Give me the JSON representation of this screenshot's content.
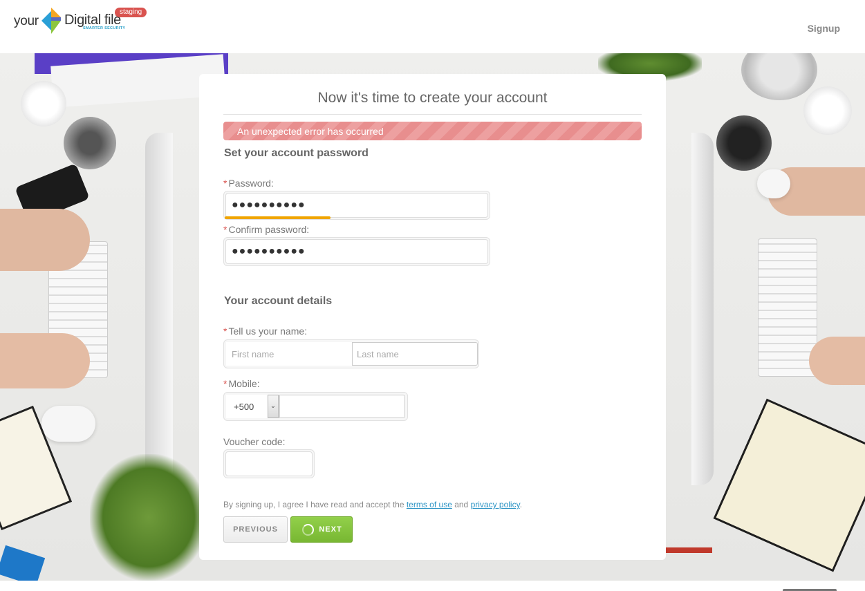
{
  "header": {
    "logo": {
      "your": "your",
      "digital": "Digital file",
      "tm": "®",
      "tagline": "SMARTER SECURITY",
      "badge": "staging"
    },
    "signup_link": "Signup"
  },
  "form": {
    "title": "Now it's time to create your account",
    "error": "An unexpected error has occurred",
    "password_section": {
      "heading": "Set your account password",
      "password_label": "Password:",
      "password_value": "●●●●●●●●●●",
      "confirm_label": "Confirm password:",
      "confirm_value": "●●●●●●●●●●",
      "required_mark": "*"
    },
    "details_section": {
      "heading": "Your account details",
      "name_label": "Tell us your name:",
      "first_name_placeholder": "First name",
      "last_name_placeholder": "Last name",
      "mobile_label": "Mobile:",
      "dial_code": "+500",
      "mobile_value": "",
      "voucher_label": "Voucher code:",
      "voucher_value": ""
    },
    "legal": {
      "prefix": "By signing up, I agree I have read and accept the ",
      "terms": "terms of use",
      "conjunction": " and ",
      "privacy": "privacy policy",
      "suffix": "."
    },
    "buttons": {
      "previous": "PREVIOUS",
      "next": "NEXT"
    }
  },
  "colors": {
    "error": "#e88e8e",
    "next_button": "#84c43c",
    "password_strength": "#f0a500",
    "link": "#2a93c4",
    "badge": "#d9534f"
  },
  "icons": {
    "dial_dropdown": "chevron-down-icon",
    "loading": "spinner-icon",
    "logo_mark": "digital-file-logo-icon"
  }
}
